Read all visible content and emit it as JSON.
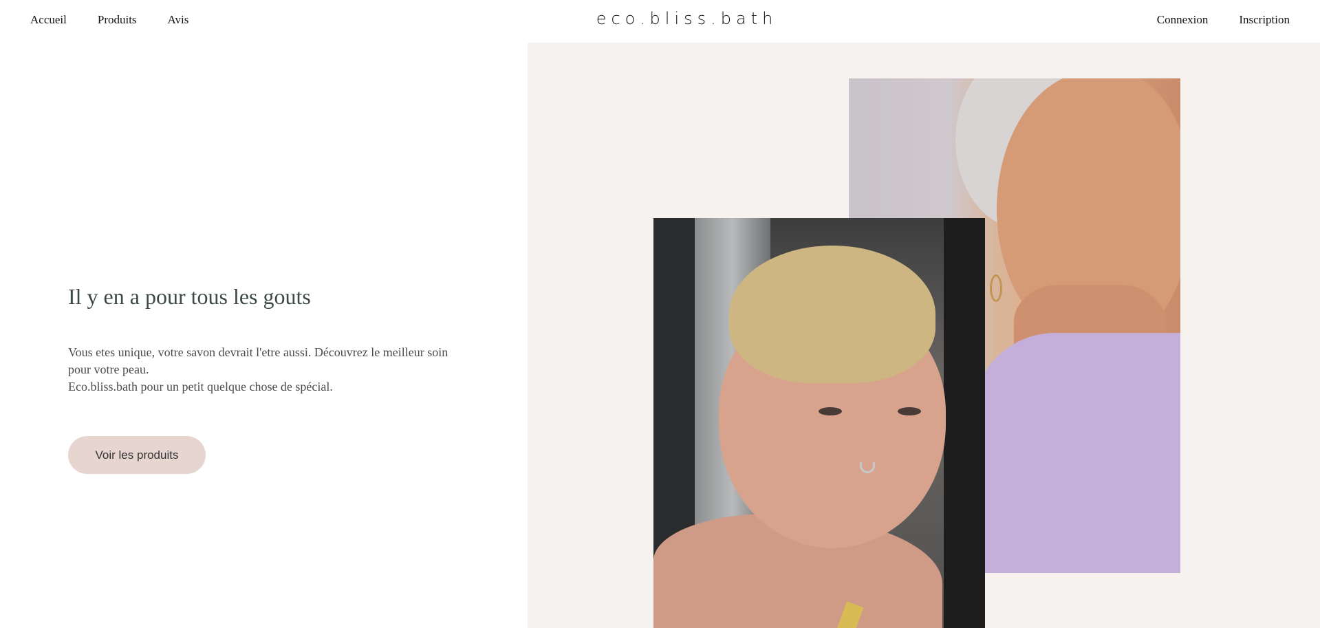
{
  "header": {
    "nav_left": [
      {
        "label": "Accueil"
      },
      {
        "label": "Produits"
      },
      {
        "label": "Avis"
      }
    ],
    "logo": "eco.bliss.bath",
    "nav_right": [
      {
        "label": "Connexion"
      },
      {
        "label": "Inscription"
      }
    ]
  },
  "hero": {
    "title": "Il y en a pour tous les gouts",
    "text_line1": "Vous etes unique, votre savon devrait l'etre aussi. Découvrez le meilleur soin pour votre peau.",
    "text_line2": "Eco.bliss.bath pour un petit quelque chose de spécial.",
    "cta_label": "Voir les produits"
  },
  "colors": {
    "accent_button": "#e6d6cf",
    "right_panel_bg": "#f5f2ef",
    "title_color": "#3c4a44"
  }
}
